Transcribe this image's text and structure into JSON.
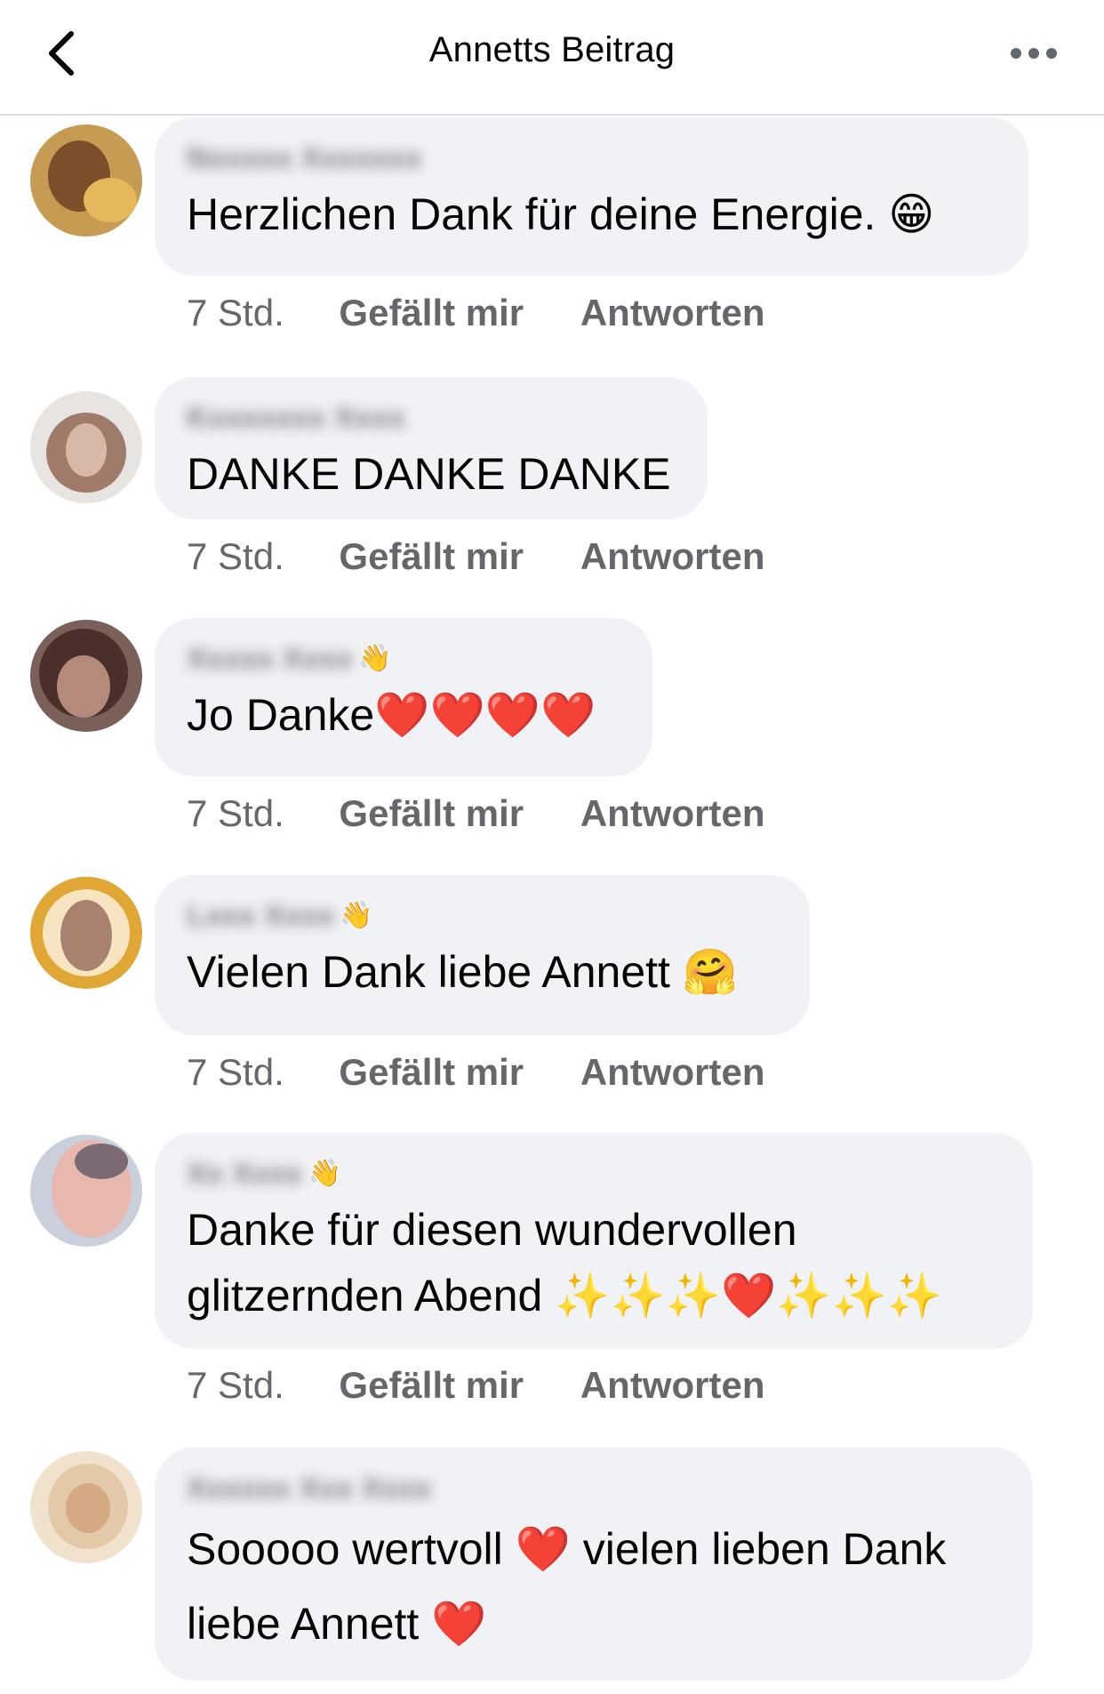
{
  "header": {
    "title": "Annetts Beitrag"
  },
  "comments": [
    {
      "author": "Nxxxxx Xxxxxxx",
      "text": "Herzlichen Dank für deine Energie. 😁",
      "time": "7 Std.",
      "like": "Gefällt mir",
      "reply": "Antworten",
      "avatar_color": "#b8843a"
    },
    {
      "author": "Kxxxxxxx Xxxx",
      "text": "DANKE DANKE DANKE",
      "time": "7 Std.",
      "like": "Gefällt mir",
      "reply": "Antworten",
      "avatar_color": "#a07b6a"
    },
    {
      "author": "Xxxxx Xxxx",
      "text": "Jo Danke❤️❤️❤️❤️",
      "time": "7 Std.",
      "like": "Gefällt mir",
      "reply": "Antworten",
      "avatar_color": "#5a4038"
    },
    {
      "author": "Lxxx Xxxx",
      "text": "Vielen Dank liebe Annett 🤗",
      "time": "7 Std.",
      "like": "Gefällt mir",
      "reply": "Antworten",
      "avatar_color": "#d9a13a"
    },
    {
      "author": "Xx Xxxx",
      "text": "Danke für diesen wundervollen glitzernden Abend ✨✨✨❤️✨✨✨",
      "time": "7 Std.",
      "like": "Gefällt mir",
      "reply": "Antworten",
      "avatar_color": "#c7a09a"
    },
    {
      "author": "Xxxxxx Xxx Xxxx",
      "text": "Sooooo wertvoll ❤️ vielen lieben Dank liebe Annett ❤️",
      "avatar_color": "#e3c9a8"
    }
  ]
}
